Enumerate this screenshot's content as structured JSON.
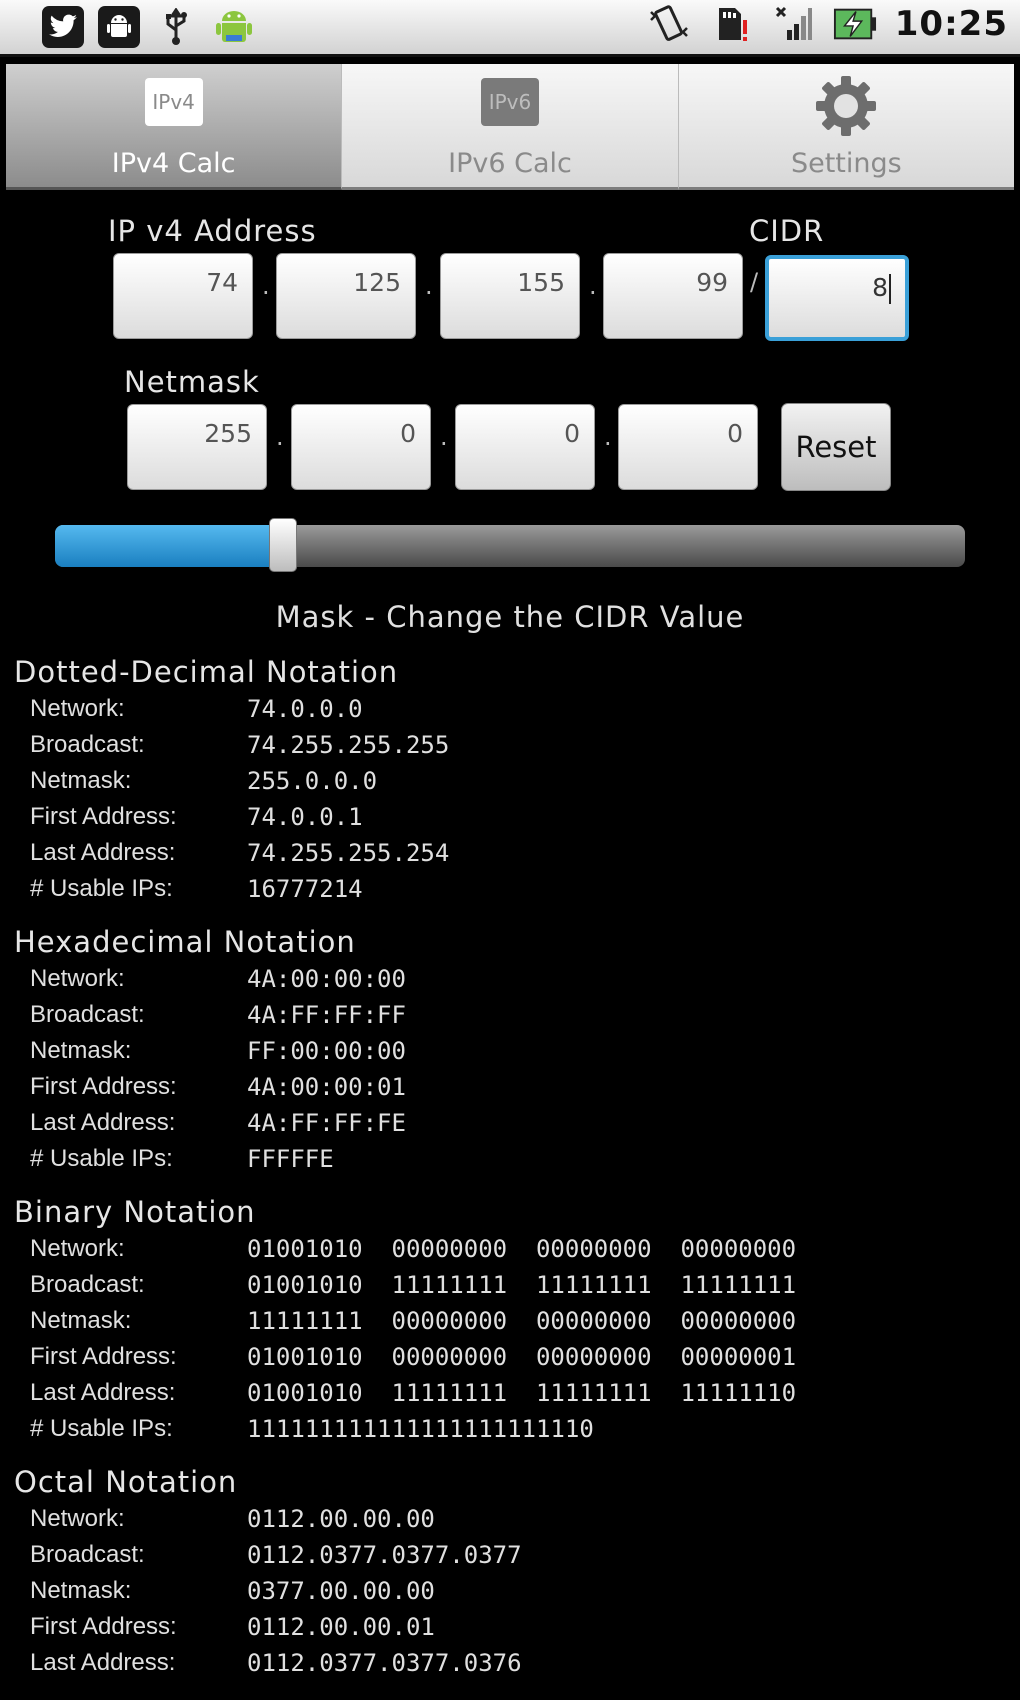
{
  "status_bar": {
    "time": "10:25",
    "icons_left": [
      "twitter-icon",
      "android-debug-icon",
      "usb-icon",
      "android-robot-icon"
    ],
    "icons_right": [
      "vibrate-icon",
      "sd-card-warning-icon",
      "signal-icon",
      "battery-charging-icon"
    ]
  },
  "tabs": [
    {
      "label": "IPv4 Calc",
      "icon_text": "IPv4",
      "selected": true
    },
    {
      "label": "IPv6 Calc",
      "icon_text": "IPv6",
      "selected": false
    },
    {
      "label": "Settings",
      "icon_text": "",
      "selected": false
    }
  ],
  "ipv4": {
    "address_label": "IP v4 Address",
    "cidr_label": "CIDR",
    "octets": [
      "74",
      "125",
      "155",
      "99"
    ],
    "cidr_value": "8",
    "slash": "/",
    "dot": "."
  },
  "netmask": {
    "label": "Netmask",
    "octets": [
      "255",
      "0",
      "0",
      "0"
    ],
    "reset_label": "Reset"
  },
  "slider": {
    "cidr_fraction": 0.25,
    "hint": "Mask - Change the CIDR Value"
  },
  "sections": [
    {
      "title": "Dotted-Decimal Notation",
      "rows": [
        {
          "key": "Network:",
          "value": "74.0.0.0"
        },
        {
          "key": "Broadcast:",
          "value": "74.255.255.255"
        },
        {
          "key": "Netmask:",
          "value": "255.0.0.0"
        },
        {
          "key": "First Address:",
          "value": "74.0.0.1"
        },
        {
          "key": "Last Address:",
          "value": "74.255.255.254"
        },
        {
          "key": "# Usable IPs:",
          "value": "16777214"
        }
      ]
    },
    {
      "title": "Hexadecimal Notation",
      "rows": [
        {
          "key": "Network:",
          "value": "4A:00:00:00"
        },
        {
          "key": "Broadcast:",
          "value": "4A:FF:FF:FF"
        },
        {
          "key": "Netmask:",
          "value": "FF:00:00:00"
        },
        {
          "key": "First Address:",
          "value": "4A:00:00:01"
        },
        {
          "key": "Last Address:",
          "value": "4A:FF:FF:FE"
        },
        {
          "key": "# Usable IPs:",
          "value": "FFFFFE"
        }
      ]
    },
    {
      "title": "Binary Notation",
      "rows": [
        {
          "key": "Network:",
          "value": "01001010  00000000  00000000  00000000"
        },
        {
          "key": "Broadcast:",
          "value": "01001010  11111111  11111111  11111111"
        },
        {
          "key": "Netmask:",
          "value": "11111111  00000000  00000000  00000000"
        },
        {
          "key": "First Address:",
          "value": "01001010  00000000  00000000  00000001"
        },
        {
          "key": "Last Address:",
          "value": "01001010  11111111  11111111  11111110"
        },
        {
          "key": "# Usable IPs:",
          "value": "111111111111111111111110"
        }
      ]
    },
    {
      "title": "Octal Notation",
      "rows": [
        {
          "key": "Network:",
          "value": "0112.00.00.00"
        },
        {
          "key": "Broadcast:",
          "value": "0112.0377.0377.0377"
        },
        {
          "key": "Netmask:",
          "value": "0377.00.00.00"
        },
        {
          "key": "First Address:",
          "value": "0112.00.00.01"
        },
        {
          "key": "Last Address:",
          "value": "0112.0377.0377.0376"
        }
      ]
    }
  ],
  "colors": {
    "accent": "#3aa0d8",
    "slider_fill": "#1a7fc0",
    "background": "#000000"
  }
}
